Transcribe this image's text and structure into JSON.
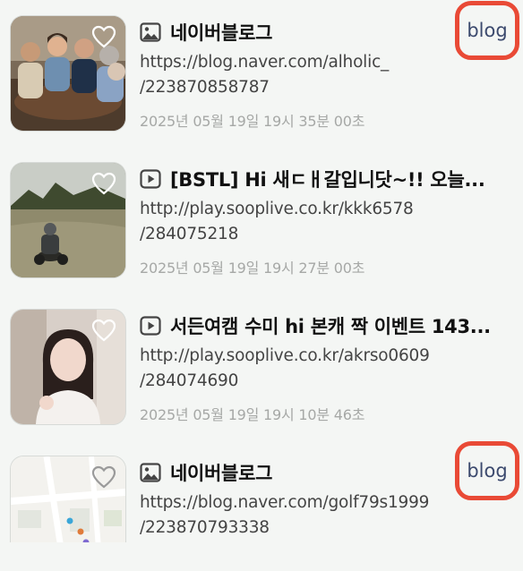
{
  "items": [
    {
      "type": "image",
      "type_icon": "image-icon",
      "title": "네이버블로그",
      "url_line1": "https://blog.naver.com/alholic_",
      "url_line2": "/223870858787",
      "date": "2025년 05월 19일 19시 35분 00초",
      "badge": "blog",
      "thumbnail": "group-of-people-at-table"
    },
    {
      "type": "video",
      "type_icon": "play-icon",
      "title": "[BSTL] Hi 새ㄷㅐ갈입니닷~!! 오늘...",
      "url_line1": "http://play.sooplive.co.kr/kkk6578",
      "url_line2": "/284075218",
      "date": "2025년 05월 19일 19시 27분 00초",
      "thumbnail": "game-scene-motorbike"
    },
    {
      "type": "video",
      "type_icon": "play-icon",
      "title": "서든여캠 수미 hi 본캐 짝 이벤트 143...",
      "url_line1": "http://play.sooplive.co.kr/akrso0609",
      "url_line2": "/284074690",
      "date": "2025년 05월 19일 19시 10분 46초",
      "thumbnail": "streamer-woman"
    },
    {
      "type": "image",
      "type_icon": "image-icon",
      "title": "네이버블로그",
      "url_line1": "https://blog.naver.com/golf79s1999",
      "url_line2": "/223870793338",
      "date": "",
      "badge": "blog",
      "thumbnail": "map"
    }
  ],
  "colors": {
    "badge_border": "#e94a36",
    "badge_text": "#3c4a6e",
    "date_text": "#a6a8a6",
    "background": "#f4f6f4"
  }
}
